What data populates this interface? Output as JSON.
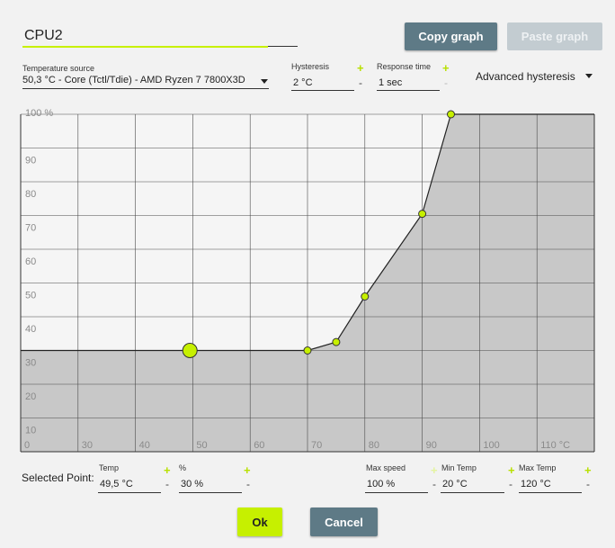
{
  "graph_name": "CPU2",
  "buttons": {
    "copy_graph": "Copy graph",
    "paste_graph": "Paste graph",
    "ok": "Ok",
    "cancel": "Cancel"
  },
  "temperature_source": {
    "label": "Temperature source",
    "value": "50,3 °C - Core (Tctl/Tdie) - AMD Ryzen 7 7800X3D"
  },
  "hysteresis": {
    "label": "Hysteresis",
    "value": "2 °C"
  },
  "response_time": {
    "label": "Response time",
    "value": "1 sec"
  },
  "advanced_hysteresis": "Advanced hysteresis",
  "plus_glyph": "+",
  "minus_glyph": "-",
  "selected_point": {
    "label": "Selected Point:",
    "temp_label": "Temp",
    "temp_value": "49,5 °C",
    "percent_label": "%",
    "percent_value": "30 %"
  },
  "max_speed": {
    "label": "Max speed",
    "value": "100 %"
  },
  "min_temp": {
    "label": "Min Temp",
    "value": "20 °C"
  },
  "max_temp": {
    "label": "Max Temp",
    "value": "120 °C"
  },
  "colors": {
    "accent": "#c6f000",
    "button_dark": "#5e7a86",
    "button_disabled": "#c3ccd1",
    "fill": "#c8c8c8"
  },
  "chart_data": {
    "type": "area",
    "x_tick_labels": [
      "0",
      "30",
      "40",
      "50",
      "60",
      "70",
      "80",
      "90",
      "100",
      "110 °C"
    ],
    "y_tick_labels": [
      "10",
      "20",
      "30",
      "40",
      "50",
      "60",
      "70",
      "80",
      "90",
      "100 %"
    ],
    "xlim": [
      20,
      120
    ],
    "ylim": [
      0,
      100
    ],
    "grid": true,
    "points": [
      {
        "x": 20,
        "y": 30
      },
      {
        "x": 49.5,
        "y": 30
      },
      {
        "x": 70,
        "y": 30
      },
      {
        "x": 75,
        "y": 32.5
      },
      {
        "x": 80,
        "y": 46
      },
      {
        "x": 90,
        "y": 70.5
      },
      {
        "x": 95,
        "y": 100
      },
      {
        "x": 120,
        "y": 100
      }
    ],
    "handles": [
      {
        "x": 49.5,
        "y": 30,
        "selected": true
      },
      {
        "x": 70,
        "y": 30
      },
      {
        "x": 75,
        "y": 32.5
      },
      {
        "x": 80,
        "y": 46
      },
      {
        "x": 90,
        "y": 70.5
      },
      {
        "x": 95,
        "y": 100
      }
    ]
  }
}
